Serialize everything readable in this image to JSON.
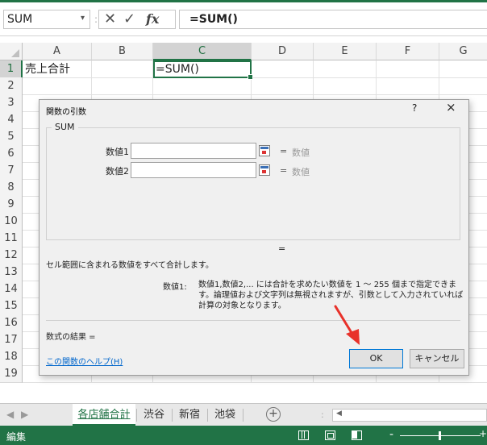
{
  "formula_bar": {
    "name_box": "SUM",
    "dropdown_icon": "chevron-down-icon",
    "separator": ":",
    "cancel_icon": "✕",
    "enter_icon": "✓",
    "fx_label": "fx",
    "formula": "=SUM()"
  },
  "columns": [
    "A",
    "B",
    "C",
    "D",
    "E",
    "F",
    "G"
  ],
  "rows": [
    "1",
    "2",
    "3",
    "4",
    "5",
    "6",
    "7",
    "8",
    "9",
    "10",
    "11",
    "12",
    "13",
    "14",
    "15",
    "16",
    "17",
    "18",
    "19"
  ],
  "cells": {
    "A1": "売上合計",
    "C1": "=SUM()"
  },
  "dialog": {
    "title": "関数の引数",
    "help": "?",
    "close": "×",
    "function_name": "SUM",
    "arg1_label": "数値1",
    "arg2_label": "数値2",
    "eq": "=",
    "arg1_result": "数値",
    "arg2_result": "数値",
    "eq_mid": "=",
    "description": "セル範囲に含まれる数値をすべて合計します。",
    "arg_desc_name": "数値1:",
    "arg_desc_text": "数値1,数値2,... には合計を求めたい数値を 1 ～ 255 個まで指定できます。論理値および文字列は無視されますが、引数として入力されていれば計算の対象となります。",
    "result_label": "数式の結果 =",
    "help_link": "この関数のヘルプ(H)",
    "ok_label": "OK",
    "cancel_label": "キャンセル"
  },
  "sheet_tabs": {
    "prev": "◀",
    "next": "▶",
    "tabs": [
      "各店舗合計",
      "渋谷",
      "新宿",
      "池袋"
    ],
    "active_index": 0,
    "add": "+",
    "dots": ":",
    "scroll_left": "◀"
  },
  "status_bar": {
    "mode": "編集",
    "zoom_minus": "-",
    "zoom_plus": "+"
  },
  "colors": {
    "excel_green": "#217346",
    "dialog_bg": "#f0f0f0",
    "arrow": "#e8312a",
    "link": "#0066cc"
  }
}
